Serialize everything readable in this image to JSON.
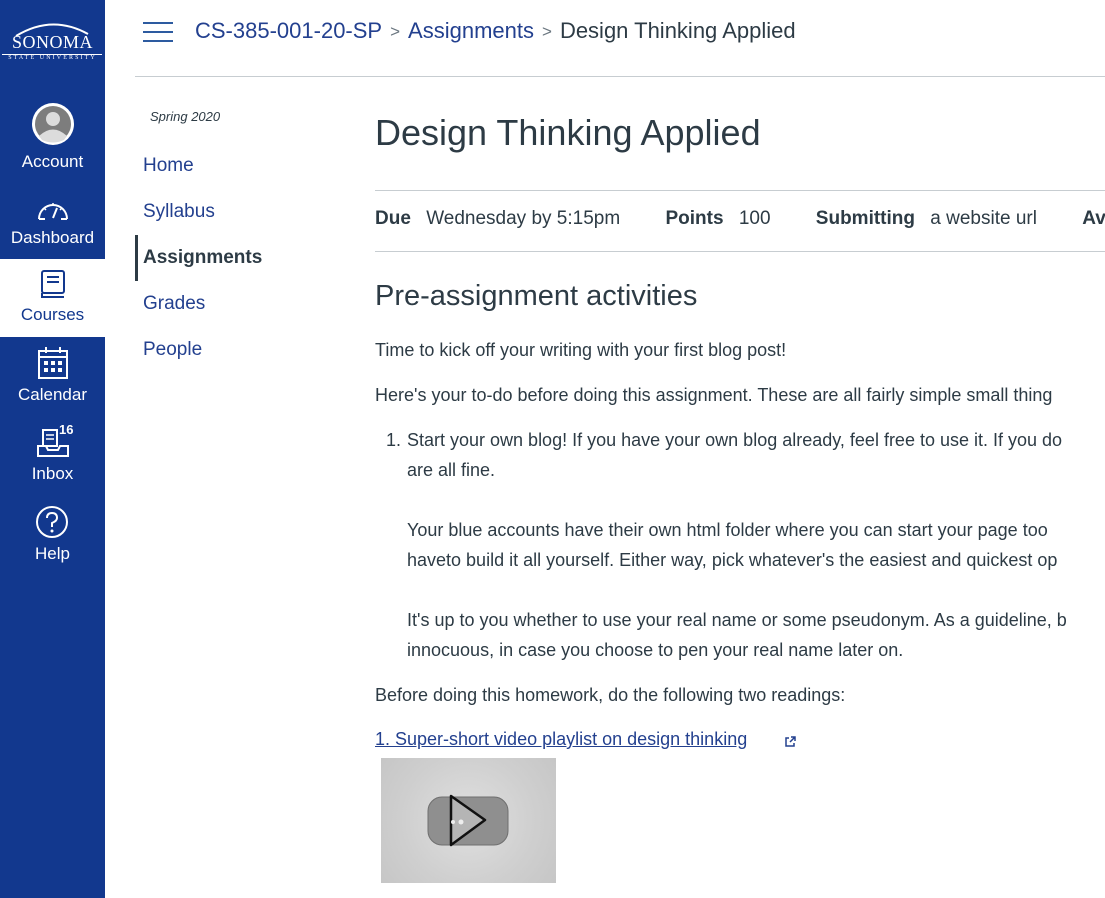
{
  "logo": {
    "name": "SONOMA",
    "subtitle": "STATE UNIVERSITY"
  },
  "global_nav": [
    {
      "label": "Account",
      "icon": "account-avatar-icon"
    },
    {
      "label": "Dashboard",
      "icon": "dashboard-icon"
    },
    {
      "label": "Courses",
      "icon": "courses-icon",
      "active": true
    },
    {
      "label": "Calendar",
      "icon": "calendar-icon"
    },
    {
      "label": "Inbox",
      "icon": "inbox-icon",
      "badge": "16"
    },
    {
      "label": "Help",
      "icon": "help-icon"
    }
  ],
  "breadcrumb": {
    "course": "CS-385-001-20-SP",
    "section": "Assignments",
    "current": "Design Thinking Applied",
    "separator": ">"
  },
  "course_nav": {
    "term": "Spring 2020",
    "items": [
      {
        "label": "Home"
      },
      {
        "label": "Syllabus"
      },
      {
        "label": "Assignments",
        "active": true
      },
      {
        "label": "Grades"
      },
      {
        "label": "People"
      }
    ]
  },
  "assignment": {
    "title": "Design Thinking Applied",
    "due_label": "Due",
    "due_value": "Wednesday by 5:15pm",
    "points_label": "Points",
    "points_value": "100",
    "submitting_label": "Submitting",
    "submitting_value": "a website url",
    "available_label": "Av"
  },
  "body": {
    "heading": "Pre-assignment activities",
    "intro": "Time to kick off your writing with your first blog post!",
    "todo": "Here's your to-do before doing this assignment. These are all fairly simple small thing",
    "list_number": "1.",
    "item_line1": "Start your own blog! If you have your own blog already, feel free to use it. If you do",
    "item_line2": "are all fine.",
    "item_p2_line1": "Your blue accounts have their own html folder where you can start your page too",
    "item_p2_line2": "haveto build it all yourself. Either way, pick whatever's the easiest and quickest op",
    "item_p3_line1": "It's up to you whether to use your real name or some pseudonym. As a guideline, b",
    "item_p3_line2": "innocuous, in case you choose to pen your real name later on.",
    "readings_intro": "Before doing this homework, do the following two readings:",
    "link1": "1. Super-short video playlist on design thinking"
  },
  "colors": {
    "nav_bg": "#12388e",
    "link": "#23408f",
    "text": "#2d3b45",
    "rule": "#c7cdd1"
  }
}
